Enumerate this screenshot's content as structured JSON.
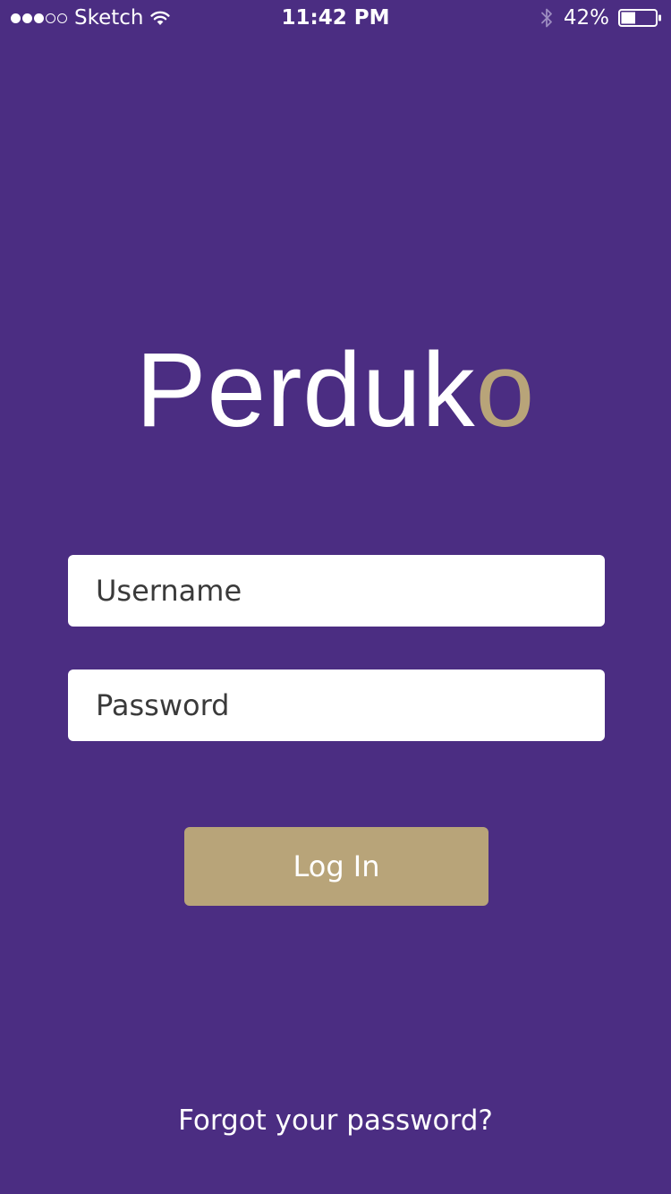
{
  "status_bar": {
    "signal_strength": 3,
    "signal_max": 5,
    "carrier": "Sketch",
    "time": "11:42 PM",
    "battery_percent_label": "42%",
    "battery_level": 0.42,
    "icons": [
      "signal-dots",
      "wifi-icon",
      "bluetooth-icon",
      "battery-icon"
    ]
  },
  "logo": {
    "main": "Perduk",
    "accent": "o"
  },
  "form": {
    "username_placeholder": "Username",
    "password_placeholder": "Password",
    "login_label": "Log In",
    "forgot_label": "Forgot your password?"
  },
  "colors": {
    "background": "#4b2d82",
    "accent": "#b8a479",
    "field_background": "#ffffff"
  }
}
